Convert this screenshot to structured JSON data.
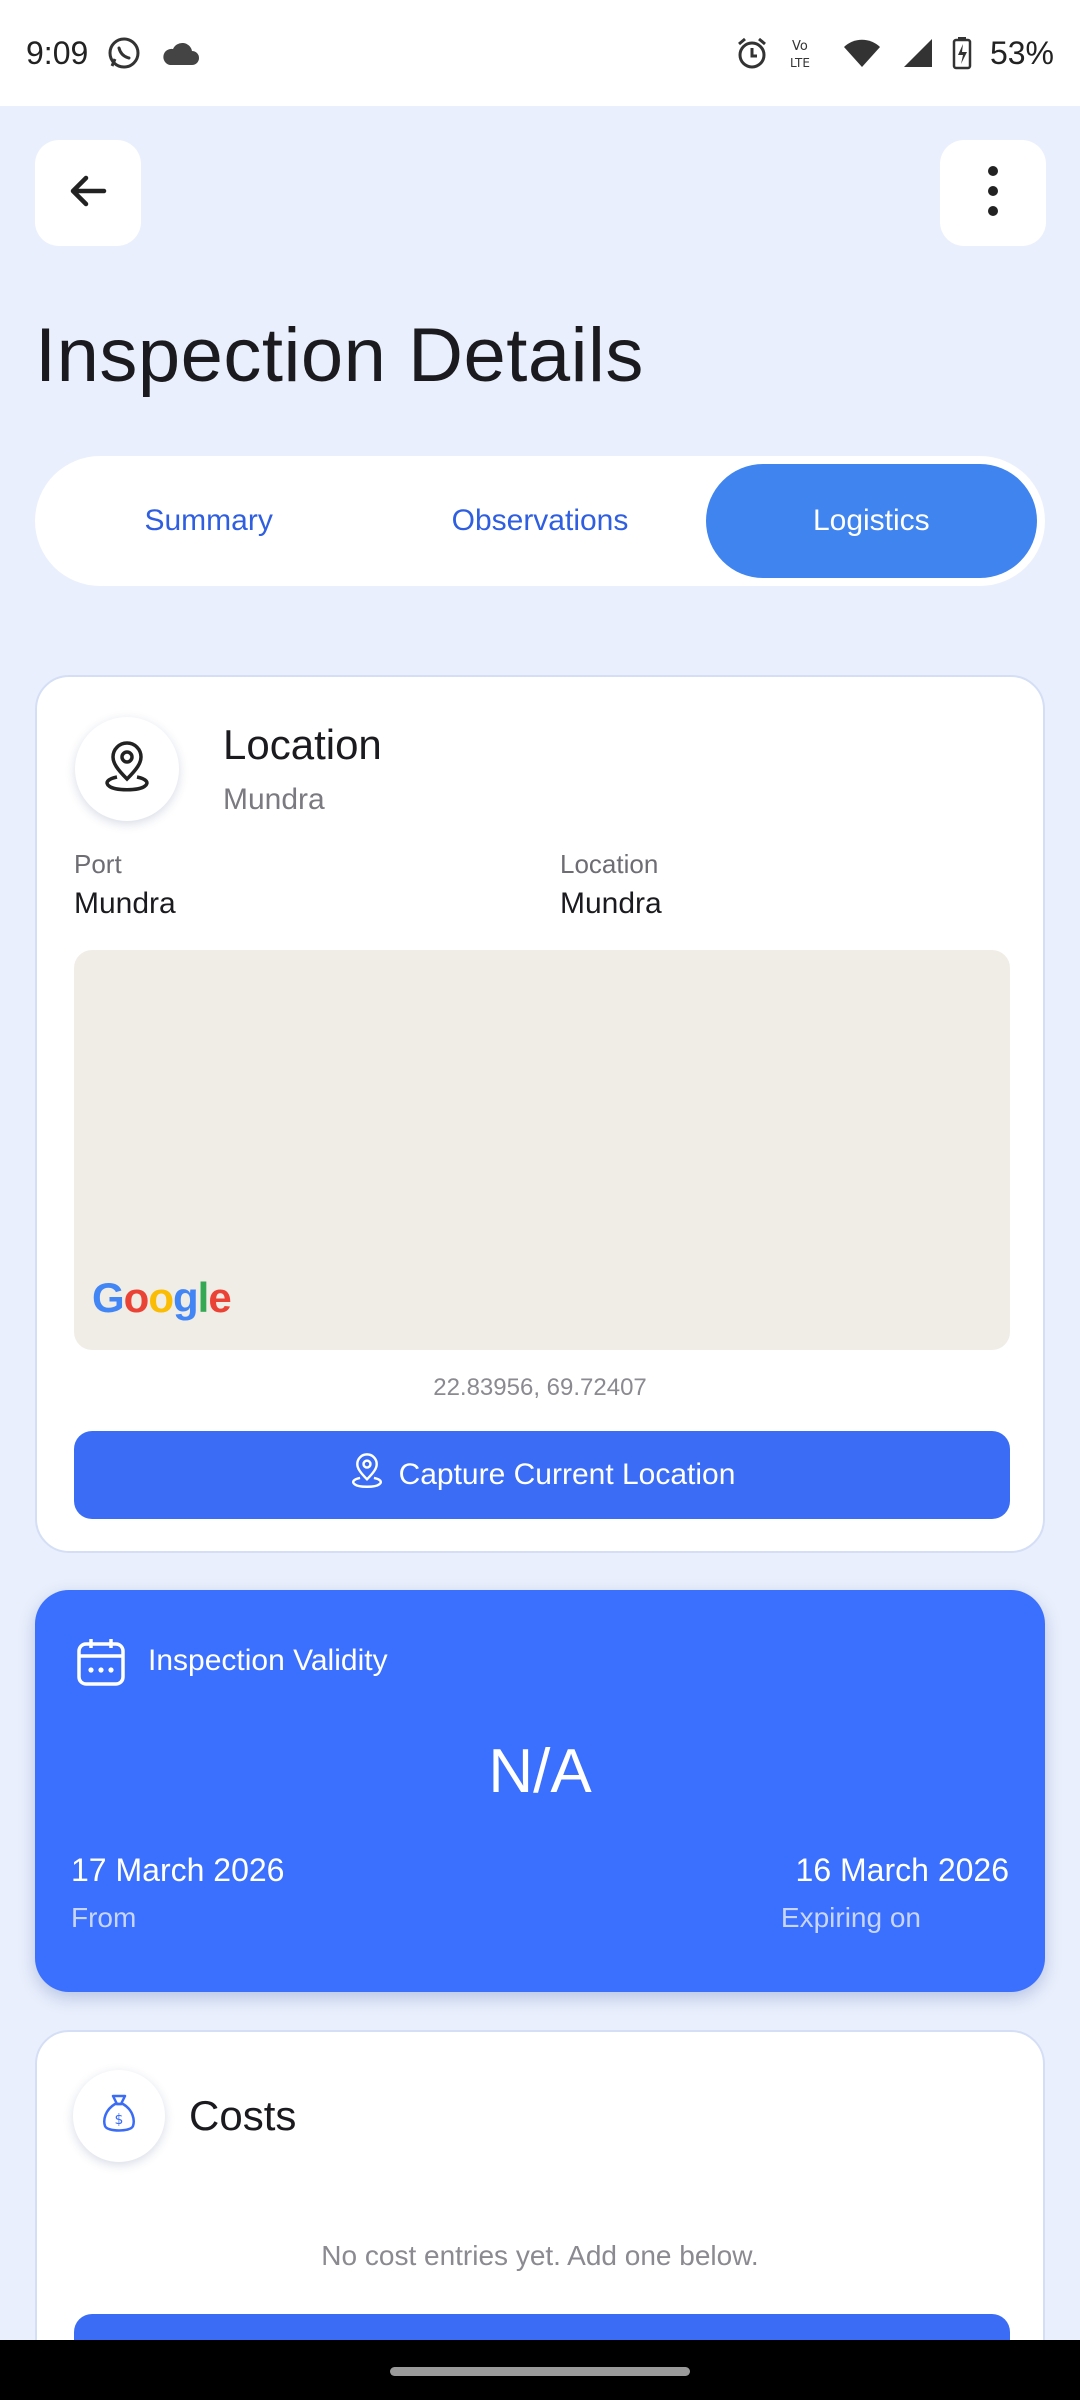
{
  "status_bar": {
    "time": "9:09",
    "battery": "53%",
    "icons": [
      "whatsapp-icon",
      "cloud-icon",
      "alarm-icon",
      "volte-icon",
      "wifi-icon",
      "signal-icon",
      "battery-charging-icon"
    ]
  },
  "header": {
    "title": "Inspection Details",
    "back_icon": "arrow-left-icon",
    "menu_icon": "more-vertical-icon"
  },
  "tabs": [
    {
      "label": "Summary",
      "active": false
    },
    {
      "label": "Observations",
      "active": false
    },
    {
      "label": "Logistics",
      "active": true
    }
  ],
  "location": {
    "title": "Location",
    "subtitle": "Mundra",
    "port_label": "Port",
    "port_value": "Mundra",
    "location_label": "Location",
    "location_value": "Mundra",
    "map_attribution": "Google",
    "coordinates": "22.83956, 69.72407",
    "capture_button": "Capture Current Location"
  },
  "validity": {
    "title": "Inspection Validity",
    "status": "N/A",
    "from_date": "17 March 2026",
    "from_label": "From",
    "expiry_date": "16 March 2026",
    "expiry_label": "Expiring on"
  },
  "costs": {
    "title": "Costs",
    "empty_message": "No cost entries yet. Add one below."
  },
  "colors": {
    "accent": "#3b6cf6",
    "tab_active": "#3f84ef",
    "background": "#e9effc",
    "validity_card": "#3b6ffd"
  }
}
